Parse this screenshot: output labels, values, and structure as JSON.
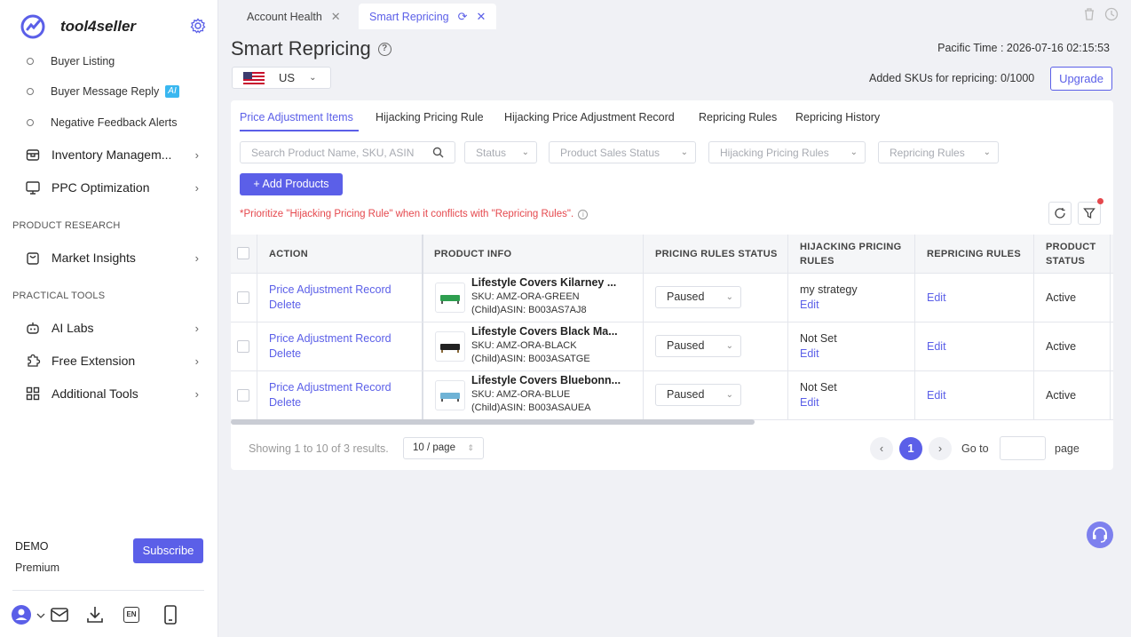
{
  "brand": {
    "name": "tool4seller"
  },
  "sidebar": {
    "sub_items": [
      {
        "label": "Buyer Listing"
      },
      {
        "label": "Buyer Message Reply",
        "badge": "AI"
      },
      {
        "label": "Negative Feedback Alerts"
      }
    ],
    "items_top": [
      {
        "label": "Inventory Managem...",
        "icon": "box-icon"
      },
      {
        "label": "PPC Optimization",
        "icon": "monitor-icon"
      }
    ],
    "section_research": "PRODUCT RESEARCH",
    "research_items": [
      {
        "label": "Market Insights",
        "icon": "bag-icon"
      }
    ],
    "section_tools": "PRACTICAL TOOLS",
    "tool_items": [
      {
        "label": "AI Labs",
        "icon": "robot-icon"
      },
      {
        "label": "Free Extension",
        "icon": "puzzle-icon"
      },
      {
        "label": "Additional Tools",
        "icon": "grid-icon"
      }
    ],
    "account": {
      "name": "DEMO",
      "plan": "Premium",
      "subscribe_label": "Subscribe"
    },
    "lang_badge": "EN"
  },
  "tabs": [
    {
      "label": "Account Health"
    },
    {
      "label": "Smart Repricing"
    }
  ],
  "header": {
    "title": "Smart Repricing",
    "region": "US",
    "pacific_time": "Pacific Time : 2026-07-16 02:15:53",
    "added_skus": "Added SKUs for repricing: 0/1000",
    "upgrade_label": "Upgrade"
  },
  "subtabs": [
    "Price Adjustment Items",
    "Hijacking Pricing Rule",
    "Hijacking Price Adjustment Record",
    "Repricing Rules",
    "Repricing History"
  ],
  "filters": {
    "search_placeholder": "Search Product Name, SKU, ASIN",
    "status": "Status",
    "product_sales_status": "Product Sales Status",
    "hijacking_pricing_rules": "Hijacking Pricing Rules",
    "repricing_rules": "Repricing Rules"
  },
  "add_products_label": "+ Add Products",
  "warning": "*Prioritize \"Hijacking Pricing Rule\" when it conflicts with \"Repricing Rules\".",
  "table": {
    "columns": [
      "ACTION",
      "PRODUCT INFO",
      "PRICING RULES STATUS",
      "HIJACKING PRICING RULES",
      "REPRICING RULES",
      "PRODUCT STATUS"
    ],
    "rows": [
      {
        "action_record": "Price Adjustment Record",
        "action_delete": "Delete",
        "name": "Lifestyle Covers Kilarney ...",
        "sku": "SKU: AMZ-ORA-GREEN",
        "asin": "(Child)ASIN: B003AS7AJ8",
        "thumb_color": "#2e9e4f",
        "pricing_status": "Paused",
        "hijacking_rule": "my strategy",
        "hijacking_edit": "Edit",
        "repricing_edit": "Edit",
        "product_status": "Active"
      },
      {
        "action_record": "Price Adjustment Record",
        "action_delete": "Delete",
        "name": "Lifestyle Covers Black Ma...",
        "sku": "SKU: AMZ-ORA-BLACK",
        "asin": "(Child)ASIN: B003ASATGE",
        "thumb_color": "#222222",
        "pricing_status": "Paused",
        "hijacking_rule": "Not Set",
        "hijacking_edit": "Edit",
        "repricing_edit": "Edit",
        "product_status": "Active"
      },
      {
        "action_record": "Price Adjustment Record",
        "action_delete": "Delete",
        "name": "Lifestyle Covers Bluebonn...",
        "sku": "SKU: AMZ-ORA-BLUE",
        "asin": "(Child)ASIN: B003ASAUEA",
        "thumb_color": "#6fb3d6",
        "pricing_status": "Paused",
        "hijacking_rule": "Not Set",
        "hijacking_edit": "Edit",
        "repricing_edit": "Edit",
        "product_status": "Active"
      }
    ]
  },
  "pagination": {
    "showing": "Showing 1 to 10 of 3 results.",
    "per_page": "10 / page",
    "current_page": "1",
    "goto_label": "Go to",
    "page_label": "page"
  },
  "colors": {
    "accent": "#5b5fe8",
    "warning": "#e5484d"
  }
}
